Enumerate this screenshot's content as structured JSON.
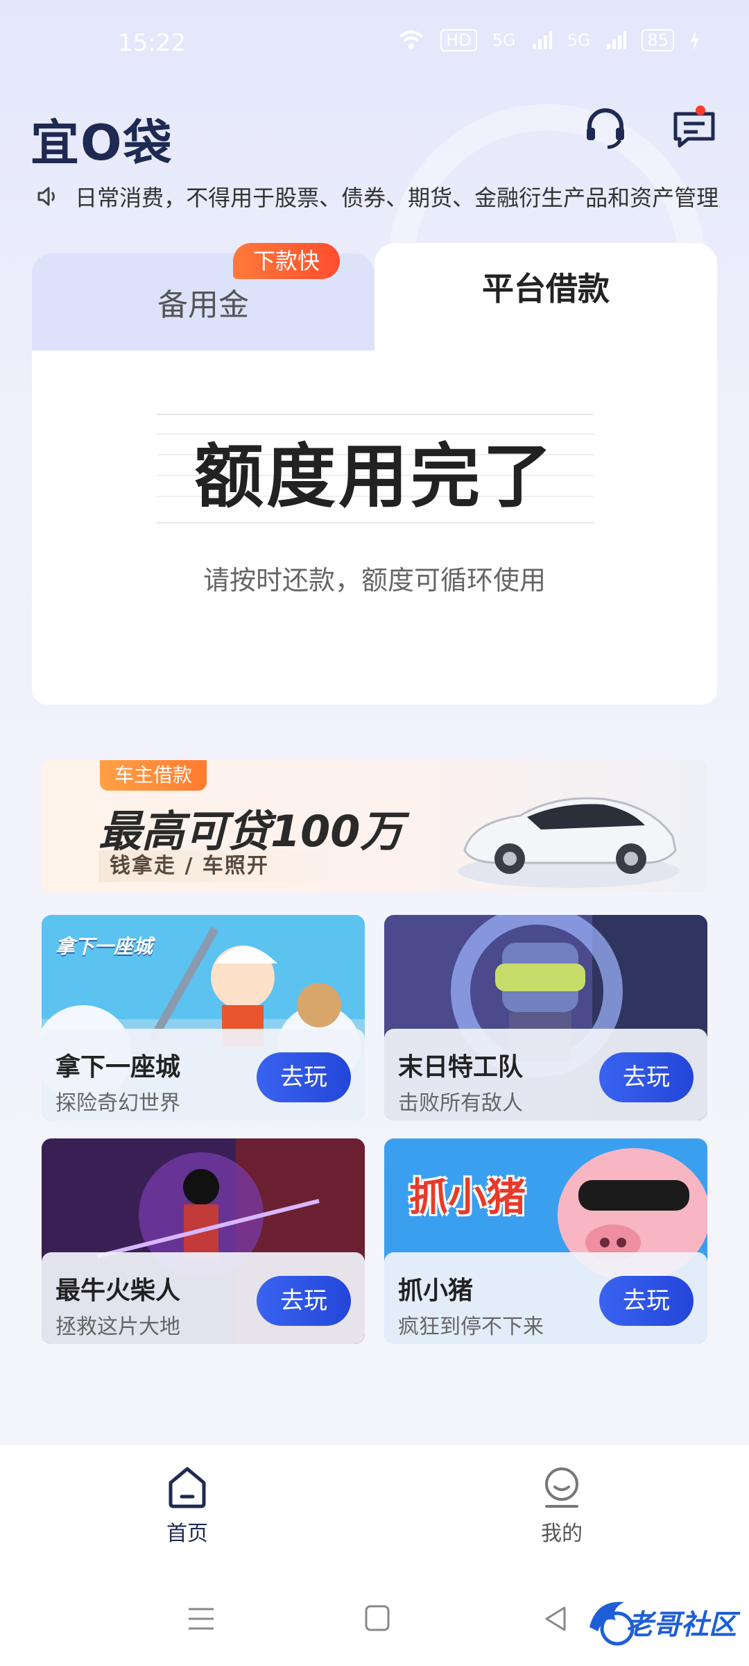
{
  "status_bar": {
    "time": "15:22",
    "network": "HD",
    "sig1": "5G",
    "sig2": "5G",
    "battery": "85"
  },
  "header": {
    "logo": "宜O袋",
    "service_icon": "headset-icon",
    "message_icon": "message-icon"
  },
  "notice": {
    "text": "日常消费，不得用于股票、债券、期货、金融衍生产品和资产管理产品"
  },
  "tabs": [
    {
      "label": "备用金",
      "badge": "下款快",
      "active": false
    },
    {
      "label": "平台借款",
      "active": true
    }
  ],
  "quota": {
    "title": "额度用完了",
    "subtitle": "请按时还款，额度可循环使用"
  },
  "banner": {
    "tag": "车主借款",
    "headline": "最高可贷100万",
    "sub": "钱拿走 / 车照开"
  },
  "games": [
    {
      "name": "拿下一座城",
      "desc": "探险奇幻世界",
      "button": "去玩",
      "art_title": "拿下一座城"
    },
    {
      "name": "末日特工队",
      "desc": "击败所有敌人",
      "button": "去玩"
    },
    {
      "name": "最牛火柴人",
      "desc": "拯救这片大地",
      "button": "去玩"
    },
    {
      "name": "抓小猪",
      "desc": "疯狂到停不下来",
      "button": "去玩",
      "art_title": "抓小猪"
    }
  ],
  "tabbar": [
    {
      "label": "首页",
      "icon": "home-icon",
      "active": true
    },
    {
      "label": "我的",
      "icon": "profile-icon",
      "active": false
    }
  ],
  "watermark": "老哥社区",
  "colors": {
    "primary": "#2346d8",
    "badge": "#ff5a30",
    "tab_active_text": "#1f2a52"
  }
}
